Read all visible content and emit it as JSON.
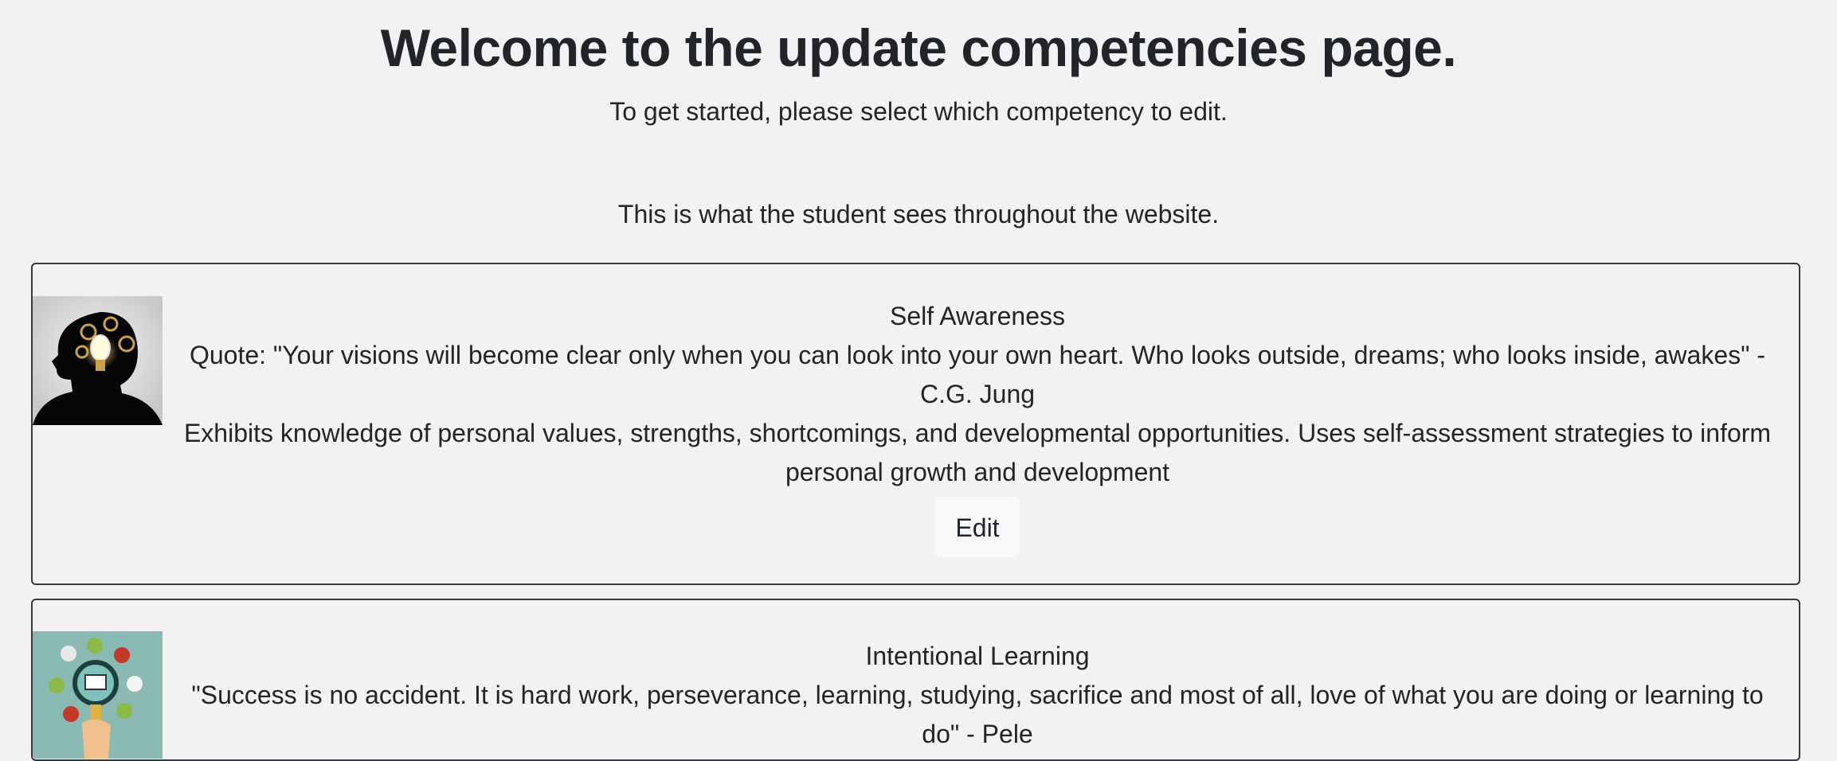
{
  "header": {
    "title": "Welcome to the update competencies page.",
    "subtitle": "To get started, please select which competency to edit.",
    "note": "This is what the student sees throughout the website."
  },
  "competencies": [
    {
      "name": "Self Awareness",
      "quote": "Quote: \"Your visions will become clear only when you can look into your own heart. Who looks outside, dreams; who looks inside, awakes\" - C.G. Jung",
      "description": "Exhibits knowledge of personal values, strengths, shortcomings, and developmental opportunities. Uses self-assessment strategies to inform personal growth and development",
      "edit_label": "Edit",
      "icon": "head-lightbulb-icon"
    },
    {
      "name": "Intentional Learning",
      "quote": "\"Success is no accident. It is hard work, perseverance, learning, studying, sacrifice and most of all, love of what you are doing or learning to do\" - Pele",
      "icon": "magnifier-learning-icon"
    }
  ]
}
